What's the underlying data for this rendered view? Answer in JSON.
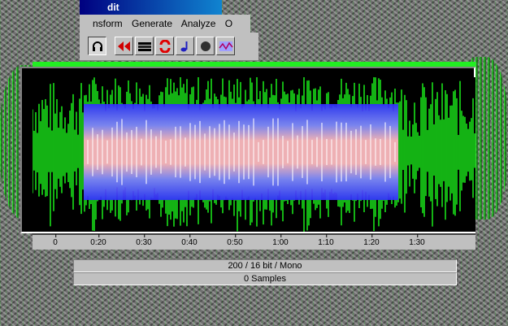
{
  "window": {
    "title": "dit"
  },
  "menu": {
    "items": [
      "nsform",
      "Generate",
      "Analyze",
      "O"
    ]
  },
  "toolbar": {
    "buttons": [
      {
        "icon": "headphones-icon",
        "pressed": true
      },
      {
        "icon": "rewind-icon",
        "pressed": false
      },
      {
        "icon": "equalizer-icon",
        "pressed": false
      },
      {
        "icon": "loop-icon",
        "pressed": false
      },
      {
        "icon": "music-note-icon",
        "pressed": false
      },
      {
        "icon": "record-icon",
        "pressed": false
      },
      {
        "icon": "spectral-icon",
        "pressed": false
      }
    ]
  },
  "timeline": {
    "ticks": [
      "0",
      "0:20",
      "0:30",
      "0:40",
      "0:50",
      "1:00",
      "1:10",
      "1:20",
      "1:30"
    ]
  },
  "status": {
    "format": "200 / 16 bit / Mono",
    "samples": "0 Samples"
  },
  "colors": {
    "waveform": "#1cff1c",
    "selection_low": "#2020ff",
    "selection_high": "#ffb0b0",
    "background": "#000000",
    "ui_face": "#c0c0c0"
  }
}
